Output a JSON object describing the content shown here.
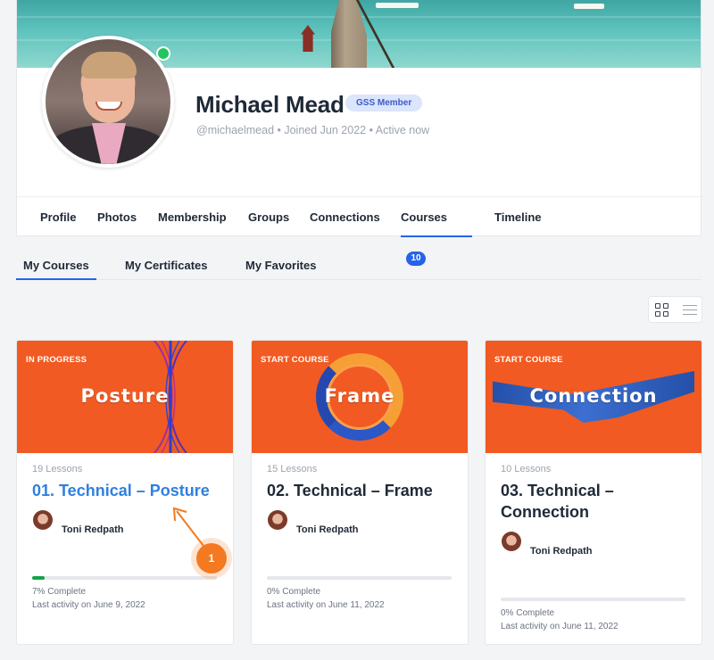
{
  "profile": {
    "name": "Michael Mead",
    "badge": "GSS Member",
    "meta": "@michaelmead • Joined Jun 2022 • Active now"
  },
  "nav": {
    "items": [
      "Profile",
      "Photos",
      "Membership",
      "Groups",
      "Connections",
      "Courses",
      "Timeline"
    ],
    "courses_count": "10",
    "active": "Courses"
  },
  "subtabs": {
    "items": [
      "My Courses",
      "My Certificates",
      "My Favorites"
    ],
    "active": "My Courses"
  },
  "view_toggle": {
    "grid_icon": "grid-icon",
    "list_icon": "list-icon",
    "active": "grid"
  },
  "courses": [
    {
      "status": "IN PROGRESS",
      "cover_word": "Posture",
      "lessons": "19 Lessons",
      "title": "01. Technical – Posture",
      "author": "Toni Redpath",
      "progress_percent": 7,
      "complete": "7% Complete",
      "activity": "Last activity on June 9, 2022"
    },
    {
      "status": "START COURSE",
      "cover_word": "Frame",
      "lessons": "15 Lessons",
      "title": "02. Technical – Frame",
      "author": "Toni Redpath",
      "progress_percent": 0,
      "complete": "0% Complete",
      "activity": "Last activity on June 11, 2022"
    },
    {
      "status": "START COURSE",
      "cover_word": "Connection",
      "lessons": "10 Lessons",
      "title": "03. Technical – Connection",
      "author": "Toni Redpath",
      "progress_percent": 0,
      "complete": "0% Complete",
      "activity": "Last activity on June 11, 2022"
    }
  ],
  "annotation": {
    "label": "1"
  },
  "colors": {
    "accent": "#2563eb",
    "cover_orange": "#f15a22",
    "progress_green": "#16a34a",
    "annotation_orange": "#f47920"
  }
}
